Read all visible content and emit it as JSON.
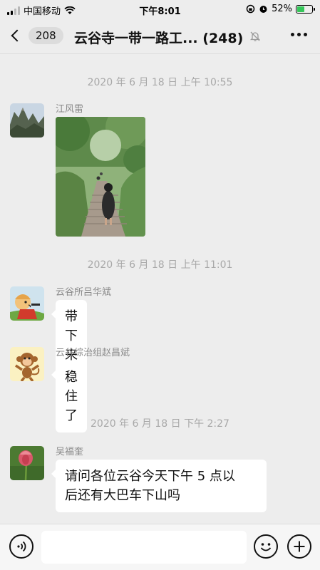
{
  "status_bar": {
    "carrier": "中国移动",
    "time": "下午8:01",
    "battery": "52%",
    "battery_level": 0.52,
    "icons": [
      "signal-icon",
      "wifi-icon",
      "orientation-lock-icon",
      "alarm-icon",
      "battery-icon"
    ]
  },
  "nav": {
    "unread_count": "208",
    "title": "云谷寺一带一路工... (248)",
    "icons": [
      "back-chevron-icon",
      "mute-bell-icon",
      "more-icon"
    ]
  },
  "messages": [
    {
      "type": "timestamp",
      "text": "2020 年 6 月 18 日  上午 10:55"
    },
    {
      "type": "image",
      "sender": "江风雷",
      "avatar": "mountain-avatar",
      "image": "hiking-trail-photo"
    },
    {
      "type": "timestamp",
      "text": "2020 年 6 月 18 日  上午 11:01"
    },
    {
      "type": "text",
      "sender": "云谷所吕华斌",
      "avatar": "cartoon-man-avatar",
      "text": "带下来吧"
    },
    {
      "type": "text",
      "sender": "云谷综治组赵昌斌",
      "avatar": "monkey-avatar",
      "text": "稳住了"
    },
    {
      "type": "timestamp",
      "text": "2020 年 6 月 18 日  下午 2:27"
    },
    {
      "type": "text",
      "sender": "吴福奎",
      "avatar": "tulip-avatar",
      "text_lines": [
        "请问各位云谷今天下午 5 点以",
        "后还有大巴车下山吗"
      ]
    }
  ],
  "input_bar": {
    "placeholder": "",
    "icons": [
      "voice-icon",
      "emoji-icon",
      "plus-icon"
    ]
  }
}
